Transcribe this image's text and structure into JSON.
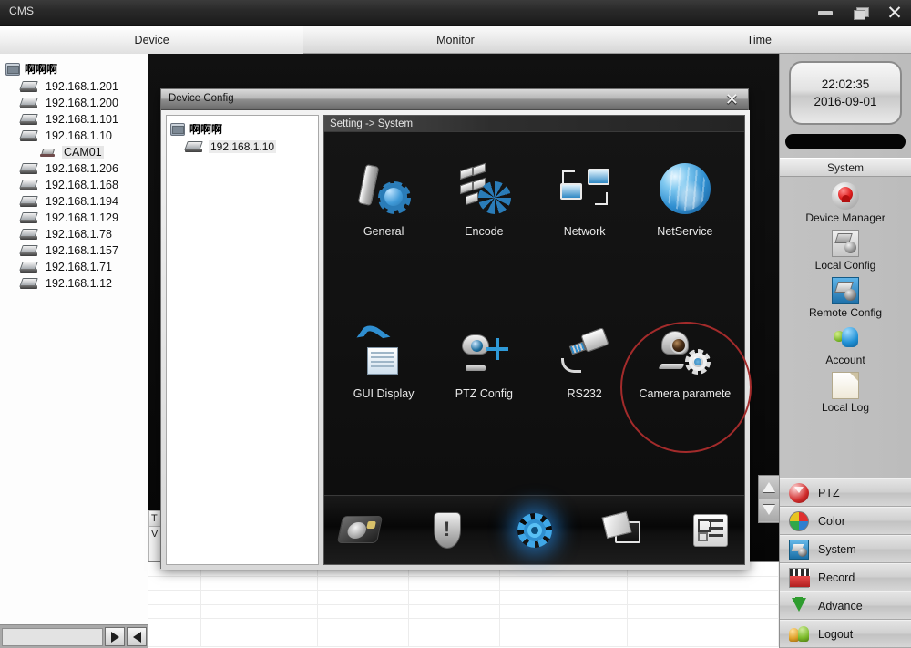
{
  "window": {
    "app_title": "CMS",
    "controls": {
      "minimize": "minimize-button",
      "restore": "restore-button",
      "close": "close-button"
    }
  },
  "tabs": [
    {
      "label": "Device",
      "active": true
    },
    {
      "label": "Monitor",
      "active": false
    },
    {
      "label": "Time",
      "active": false
    }
  ],
  "device_tree": {
    "root": "啊啊啊",
    "items": [
      {
        "label": "192.168.1.201",
        "type": "device"
      },
      {
        "label": "192.168.1.200",
        "type": "device"
      },
      {
        "label": "192.168.1.101",
        "type": "device"
      },
      {
        "label": "192.168.1.10",
        "type": "device"
      },
      {
        "label": "CAM01",
        "type": "channel"
      },
      {
        "label": "192.168.1.206",
        "type": "device"
      },
      {
        "label": "192.168.1.168",
        "type": "device"
      },
      {
        "label": "192.168.1.194",
        "type": "device"
      },
      {
        "label": "192.168.1.129",
        "type": "device"
      },
      {
        "label": "192.168.1.78",
        "type": "device"
      },
      {
        "label": "192.168.1.157",
        "type": "device"
      },
      {
        "label": "192.168.1.71",
        "type": "device"
      },
      {
        "label": "192.168.1.12",
        "type": "device"
      }
    ]
  },
  "hidden_columns": [
    "T",
    "V"
  ],
  "dialog": {
    "title": "Device Config",
    "close_label": "✕",
    "tree": {
      "root": "啊啊啊",
      "child": "192.168.1.10"
    },
    "breadcrumb": "Setting -> System",
    "icons": [
      {
        "label": "General",
        "icon": "general-icon"
      },
      {
        "label": "Encode",
        "icon": "encode-icon"
      },
      {
        "label": "Network",
        "icon": "network-icon"
      },
      {
        "label": "NetService",
        "icon": "netservice-icon"
      },
      {
        "label": "GUI Display",
        "icon": "gui-display-icon"
      },
      {
        "label": "PTZ Config",
        "icon": "ptz-config-icon"
      },
      {
        "label": "RS232",
        "icon": "rs232-icon"
      },
      {
        "label": "Camera paramete",
        "icon": "camera-parameter-icon",
        "annotated": true
      }
    ],
    "toolbar": [
      {
        "name": "storage-tab",
        "active": false
      },
      {
        "name": "alarm-tab",
        "active": false
      },
      {
        "name": "system-tab",
        "active": true
      },
      {
        "name": "info-tab",
        "active": false
      },
      {
        "name": "advanced-tab",
        "active": false
      }
    ],
    "annotation_color": "#a32b2b"
  },
  "right_panel": {
    "clock": {
      "time": "22:02:35",
      "date": "2016-09-01"
    },
    "section_header": "System",
    "shortcuts": [
      {
        "label": "Device Manager",
        "icon": "device-manager-icon"
      },
      {
        "label": "Local Config",
        "icon": "local-config-icon"
      },
      {
        "label": "Remote Config",
        "icon": "remote-config-icon"
      },
      {
        "label": "Account",
        "icon": "account-icon"
      },
      {
        "label": "Local Log",
        "icon": "local-log-icon"
      }
    ],
    "menu": [
      {
        "label": "PTZ",
        "icon": "ptz-icon"
      },
      {
        "label": "Color",
        "icon": "color-icon"
      },
      {
        "label": "System",
        "icon": "system-icon"
      },
      {
        "label": "Record",
        "icon": "record-icon"
      },
      {
        "label": "Advance",
        "icon": "advance-icon"
      },
      {
        "label": "Logout",
        "icon": "logout-icon"
      }
    ]
  }
}
